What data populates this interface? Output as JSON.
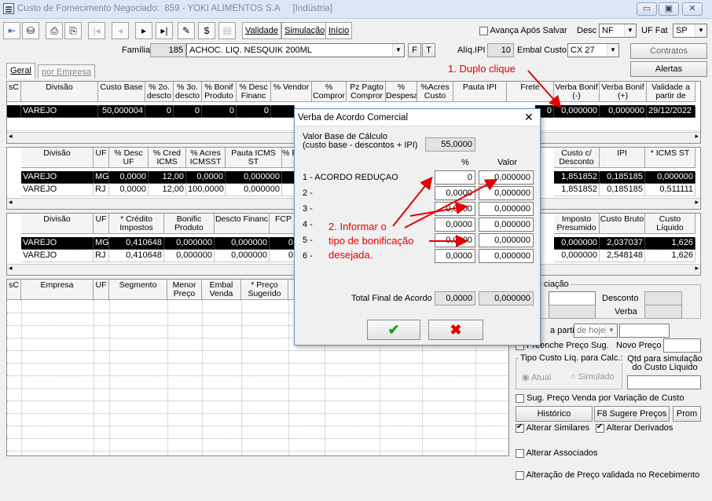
{
  "window": {
    "title": "Custo de Fornecimento Negociado:",
    "code": "859 - YOKI ALIMENTOS S.A",
    "tag": "[Indústria]"
  },
  "toolbar": {
    "validade": "Validade",
    "simulacao": "Simulação",
    "inicio": "Início",
    "avanca_label": "Avança Após Salvar",
    "desc_label": "Desc",
    "desc_value": "NF",
    "uf_fat_label": "UF Fat",
    "uf_fat_value": "SP"
  },
  "row2": {
    "familia_label": "Família",
    "familia_code": "185",
    "familia_name": "ACHOC. LIQ. NESQUIK 200ML",
    "f_btn": "F",
    "t_btn": "T",
    "aliq_ipi_label": "Alíq.IPI",
    "aliq_ipi_value": "10",
    "embal_label": "Embal Custo",
    "embal_value": "CX 27",
    "contratos": "Contratos",
    "alertas": "Alertas"
  },
  "tabs": {
    "geral": "Geral",
    "por_empresa": "por Empresa"
  },
  "grid1": {
    "headers": [
      "sC",
      "Divisão",
      "Custo Base",
      "% 2o. descto",
      "% 3o. descto",
      "% Bonif Produto",
      "% Desc Financ",
      "% Vendor",
      "% Compror",
      "Pz Pagto Compror",
      "% Despesa",
      "%Acres Custo",
      "Pauta IPI",
      "Frete",
      "Verba Bonif (-)",
      "Verba Bonif (+)",
      "Validade a partir de"
    ],
    "row": {
      "divisao": "VAREJO",
      "custo_base": "50,000004",
      "d2": "0",
      "d3": "0",
      "bonif": "0",
      "desc_fin": "0",
      "frete_tail": "0",
      "verba_menos": "0,000000",
      "verba_mais": "0,000000",
      "validade": "29/12/2022"
    }
  },
  "grid2": {
    "headers": [
      "Divisão",
      "UF",
      "% Desc UF",
      "% Cred ICMS",
      "% Acres ICMSST",
      "Pauta ICMS ST",
      "% F",
      "Custo c/ Desconto",
      "IPI",
      "* ICMS ST"
    ],
    "rows": [
      {
        "divisao": "VAREJO",
        "uf": "MG",
        "desc_uf": "0,0000",
        "cred": "12,00",
        "acres": "0,0000",
        "pauta": "0,000000",
        "custo": "1,851852",
        "ipi": "0,185185",
        "icms": "0,000000"
      },
      {
        "divisao": "VAREJO",
        "uf": "RJ",
        "desc_uf": "0,0000",
        "cred": "12,00",
        "acres": "100,0000",
        "pauta": "0,000000",
        "custo": "1,851852",
        "ipi": "0,185185",
        "icms": "0,511111"
      }
    ]
  },
  "grid3": {
    "headers": [
      "Divisão",
      "UF",
      "* Crédito Impostos",
      "Bonific Produto",
      "Descto Financ",
      "FCP",
      "Imposto Presumido",
      "Custo Bruto",
      "Custo Líquido"
    ],
    "rows": [
      {
        "divisao": "VAREJO",
        "uf": "MG",
        "credito": "0,410648",
        "bonific": "0,000000",
        "descto": "0,000000",
        "fcp": "0,",
        "imposto": "0,000000",
        "bruto": "2,037037",
        "liquido": "1,626"
      },
      {
        "divisao": "VAREJO",
        "uf": "RJ",
        "credito": "0,410648",
        "bonific": "0,000000",
        "descto": "0,000000",
        "fcp": "0,",
        "imposto": "0,000000",
        "bruto": "2,548148",
        "liquido": "1,626"
      }
    ]
  },
  "grid4": {
    "headers": [
      "sC",
      "Empresa",
      "UF",
      "Segmento",
      "Menor Preço",
      "Embal Venda",
      "* Preço Sugerido",
      "*"
    ]
  },
  "right_panel": {
    "group_title": "ciação",
    "desconto": "Desconto",
    "verba": "Verba",
    "a_partir": "a partir",
    "de_hoje": "de hoje",
    "preenche": "Preenche Preço Sug.",
    "novo_preco": "Novo Preço",
    "tipo_custo": "Tipo Custo Líq. para Calc.:",
    "atual": "Atual",
    "simulado": "Simulado",
    "qtd_sim": "Qtd para simulação do Custo Líquido",
    "sug_preco": "Sug. Preço Venda por Variação de Custo",
    "historico": "Histórico",
    "f8": "F8 Sugere Preços",
    "prom": "Prom",
    "alterar_similares": "Alterar Similares",
    "alterar_derivados": "Alterar Derivados",
    "alterar_associados": "Alterar Associados",
    "alteracao_preco": "Alteração de Preço validada no Recebimento"
  },
  "dialog": {
    "title": "Verba de Acordo Comercial",
    "base_label": "Valor Base de Cálculo",
    "base_sub": "(custo base - descontos + IPI)",
    "base_value": "55,0000",
    "col_pct": "%",
    "col_valor": "Valor",
    "rows": [
      {
        "label": "1 - ACORDO REDUÇAO",
        "pct": "0",
        "valor": "0,000000"
      },
      {
        "label": "2 -",
        "pct": "0,0000",
        "valor": "0,000000"
      },
      {
        "label": "3 -",
        "pct": "0,0000",
        "valor": "0,000000"
      },
      {
        "label": "4 -",
        "pct": "0,0000",
        "valor": "0,000000"
      },
      {
        "label": "5 -",
        "pct": "0,0000",
        "valor": "0,000000"
      },
      {
        "label": "6 -",
        "pct": "0,0000",
        "valor": "0,000000"
      }
    ],
    "total_label": "Total Final de Acordo",
    "total_pct": "0,0000",
    "total_valor": "0,000000"
  },
  "annotations": {
    "a1": "1. Duplo clique",
    "a2_line1": "2. Informar o",
    "a2_line2": "tipo de bonificação",
    "a2_line3": "desejada."
  },
  "colors": {
    "annotation": "#e00000",
    "selected_row": "#000000",
    "ok_green": "#1e9e2a",
    "cancel_red": "#e00000"
  }
}
